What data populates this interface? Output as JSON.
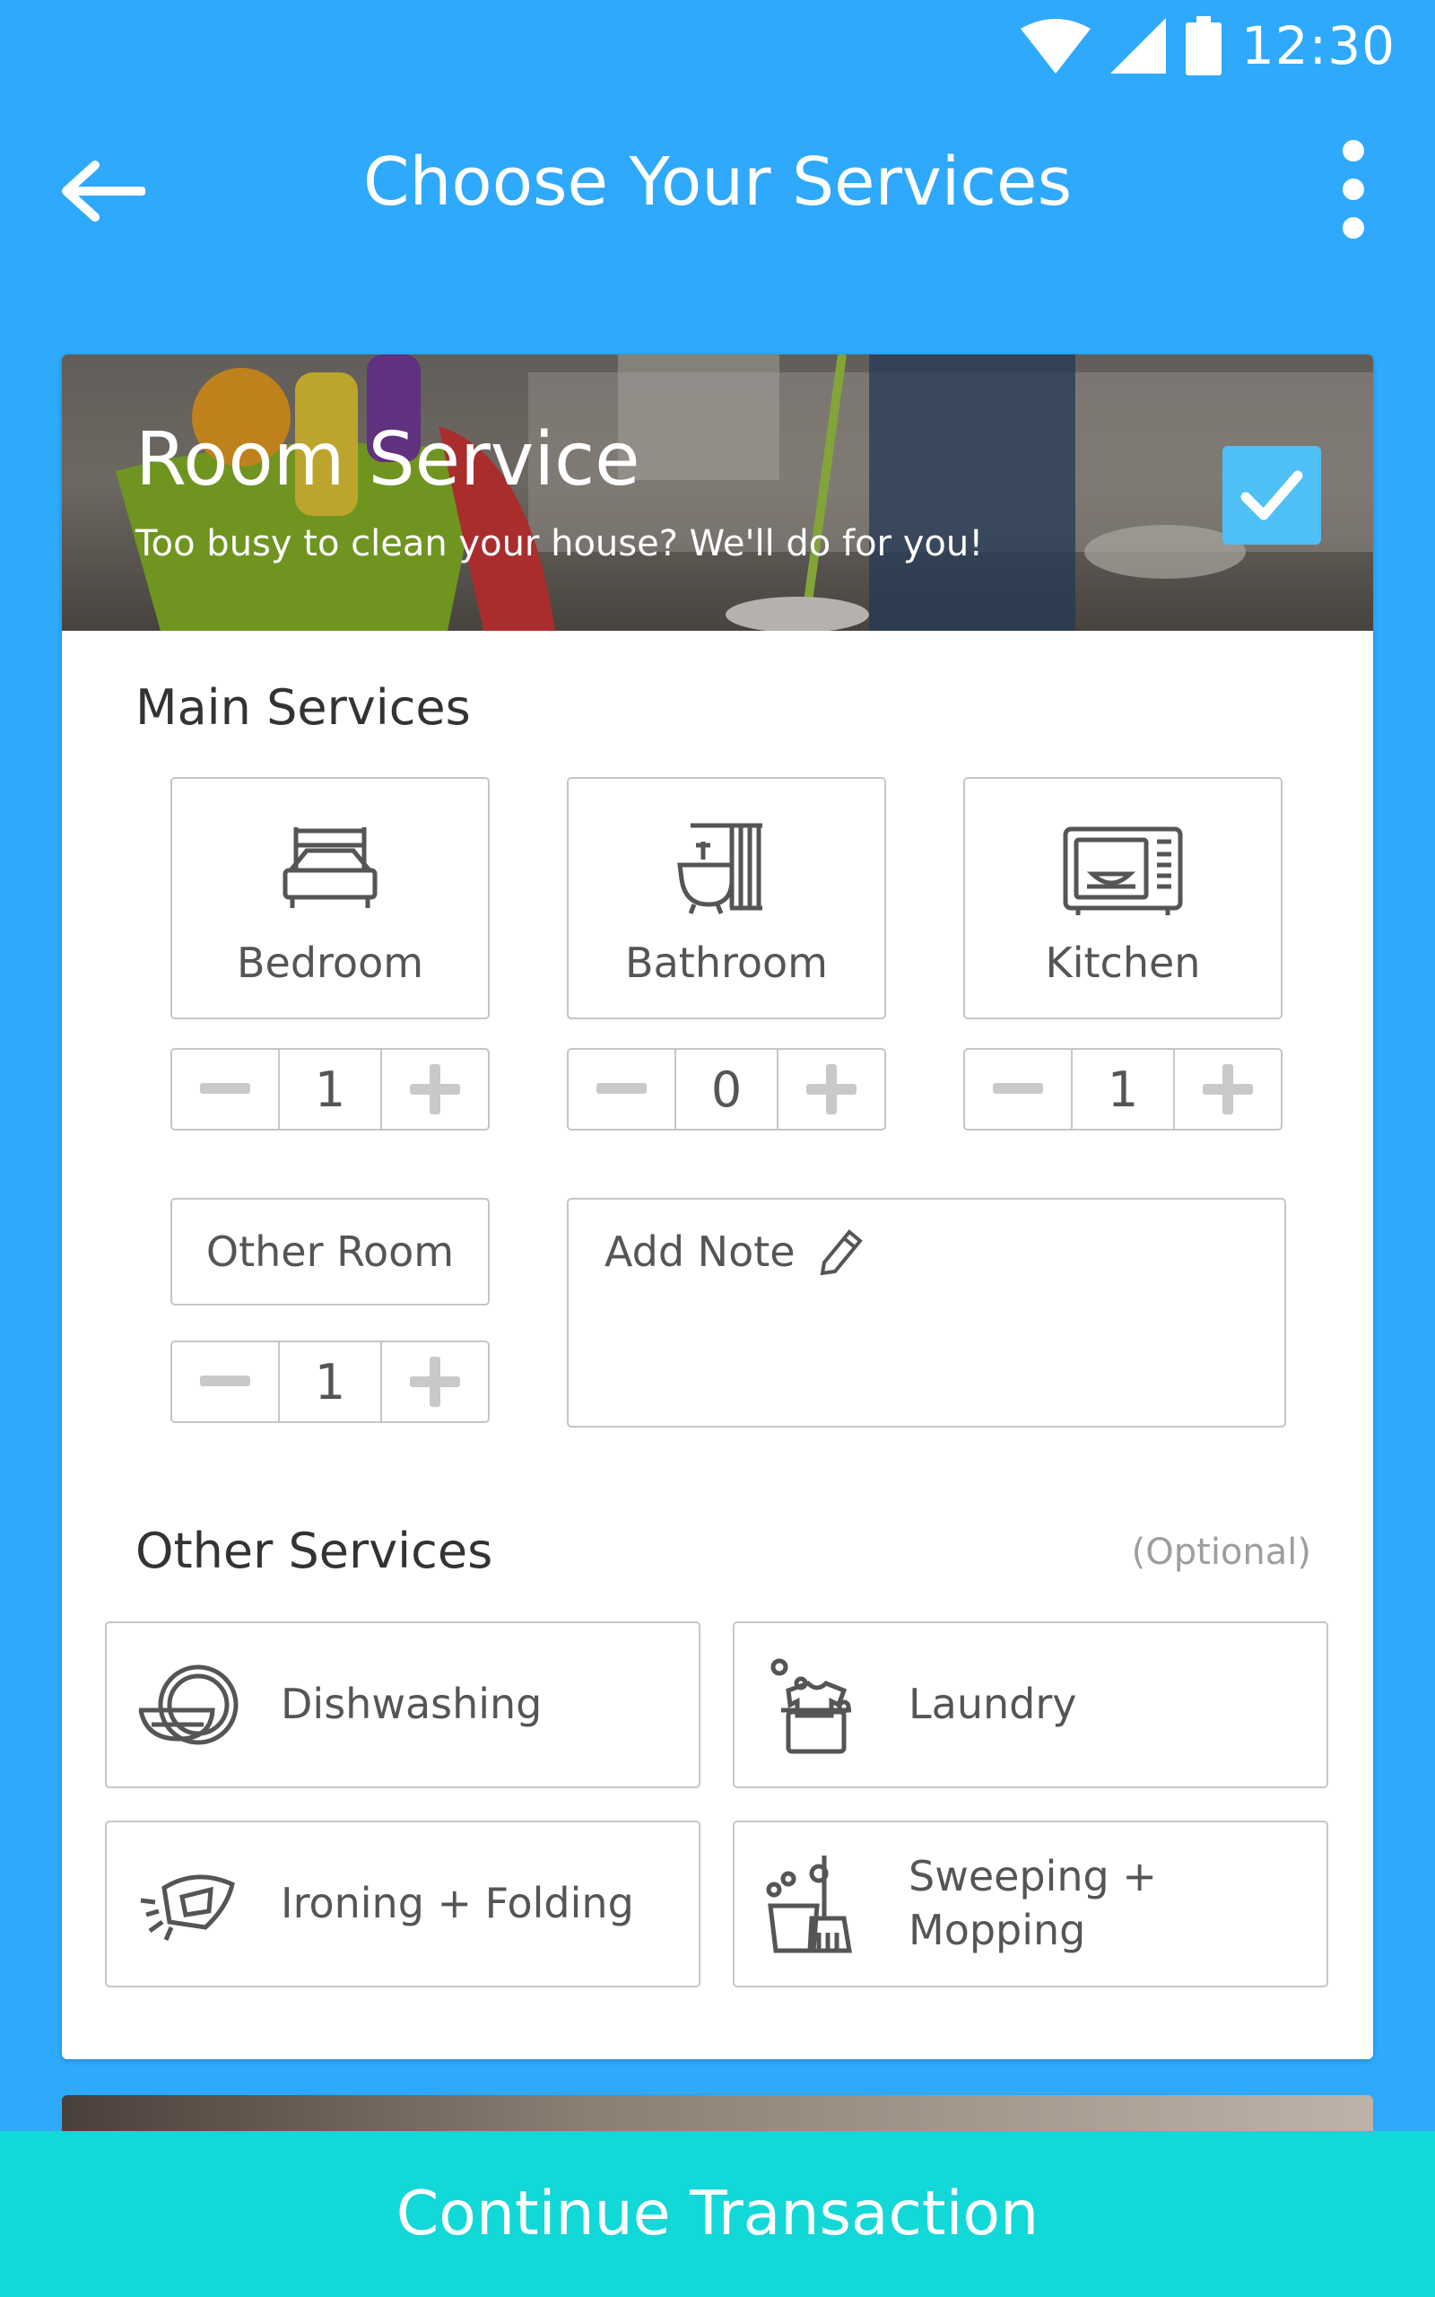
{
  "status_bar": {
    "time": "12:30"
  },
  "app_bar": {
    "title": "Choose Your Services"
  },
  "room_service": {
    "title": "Room Service",
    "subtitle": "Too busy to clean your house? We'll do for you!",
    "selected": true
  },
  "main_services": {
    "heading": "Main Services",
    "rooms": [
      {
        "label": "Bedroom",
        "icon": "bed-icon",
        "count": "1"
      },
      {
        "label": "Bathroom",
        "icon": "bathtub-icon",
        "count": "0"
      },
      {
        "label": "Kitchen",
        "icon": "microwave-icon",
        "count": "1"
      }
    ],
    "other_room": {
      "label": "Other Room",
      "count": "1"
    },
    "note": {
      "label": "Add Note",
      "icon": "pencil-icon"
    }
  },
  "other_services": {
    "heading": "Other Services",
    "optional_label": "(Optional)",
    "items": [
      {
        "label": "Dishwashing",
        "icon": "dishes-icon"
      },
      {
        "label": "Laundry",
        "icon": "laundry-icon"
      },
      {
        "label": "Ironing + Folding",
        "icon": "iron-icon"
      },
      {
        "label": "Sweeping + Mopping",
        "icon": "broom-icon"
      }
    ]
  },
  "cta": {
    "label": "Continue Transaction"
  },
  "colors": {
    "primary": "#2EA9FB",
    "accent": "#12D8D8",
    "check": "#4FC0F5"
  }
}
